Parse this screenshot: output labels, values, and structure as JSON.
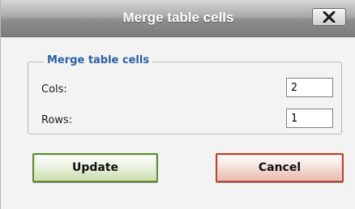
{
  "dialog": {
    "title": "Merge table cells",
    "close_icon": "close-icon"
  },
  "group": {
    "legend": "Merge table cells",
    "cols_label": "Cols:",
    "cols_value": "2",
    "rows_label": "Rows:",
    "rows_value": "1"
  },
  "buttons": {
    "update_label": "Update",
    "cancel_label": "Cancel"
  }
}
